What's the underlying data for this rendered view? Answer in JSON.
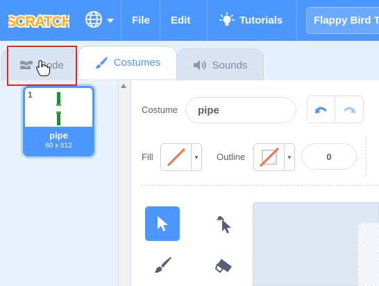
{
  "menubar": {
    "logo_text": "SCRATCH",
    "items": {
      "file": "File",
      "edit": "Edit",
      "tutorials": "Tutorials"
    },
    "project_title": "Flappy Bird T",
    "colors": {
      "background": "#4c97ff",
      "logo": "#ffab19"
    }
  },
  "tabs": {
    "code": "Code",
    "costumes": "Costumes",
    "sounds": "Sounds",
    "active": "costumes"
  },
  "costume_list": {
    "items": [
      {
        "number": "1",
        "name": "pipe",
        "size": "60 x 512",
        "selected": true
      }
    ]
  },
  "editor": {
    "costume_label": "Costume",
    "costume_name": "pipe",
    "fill_label": "Fill",
    "outline_label": "Outline",
    "outline_width": "0",
    "fill_color": "none",
    "outline_color": "none"
  },
  "icons": {
    "language": "globe-icon",
    "tutorials": "lightbulb-icon",
    "undo": "undo-icon",
    "redo": "redo-icon",
    "select": "arrow-cursor-icon",
    "reshape": "reshape-icon",
    "brush": "brush-icon",
    "eraser": "eraser-icon"
  },
  "accent_color": "#4c97ff"
}
